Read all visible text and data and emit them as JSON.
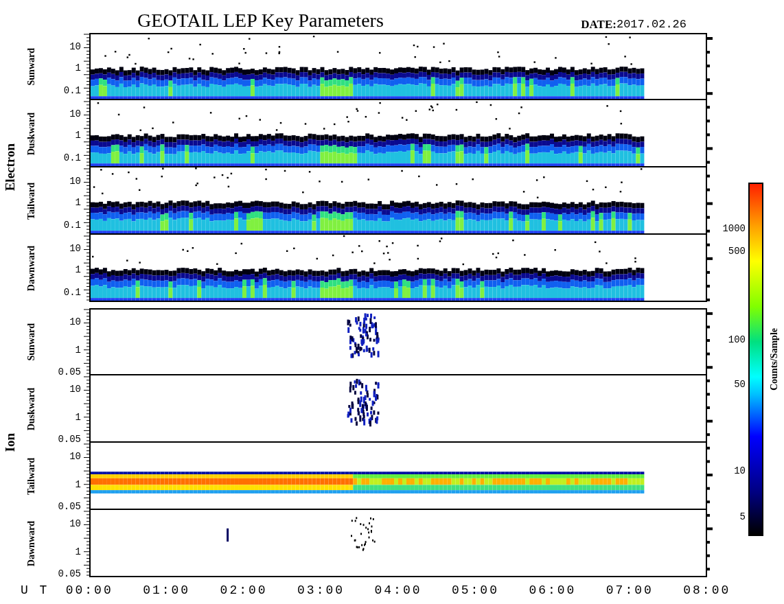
{
  "title": "GEOTAIL LEP Key Parameters",
  "date_label": "DATE:",
  "date_value": "2017.02.26",
  "groups": [
    {
      "name": "Electron",
      "panels": [
        {
          "direction": "Sunward",
          "kind": "electron",
          "yticks": [
            "10",
            "1",
            "0.1"
          ]
        },
        {
          "direction": "Duskward",
          "kind": "electron",
          "yticks": [
            "10",
            "1",
            "0.1"
          ]
        },
        {
          "direction": "Tailward",
          "kind": "electron",
          "yticks": [
            "10",
            "1",
            "0.1"
          ]
        },
        {
          "direction": "Dawnward",
          "kind": "electron",
          "yticks": [
            "10",
            "1",
            "0.1"
          ]
        }
      ]
    },
    {
      "name": "Ion",
      "panels": [
        {
          "direction": "Sunward",
          "kind": "burst",
          "yticks": [
            "10",
            "1",
            "0.05"
          ]
        },
        {
          "direction": "Duskward",
          "kind": "burst",
          "yticks": [
            "10",
            "1",
            "0.05"
          ]
        },
        {
          "direction": "Tailward",
          "kind": "band",
          "yticks": [
            "10",
            "1",
            "0.05"
          ]
        },
        {
          "direction": "Dawnward",
          "kind": "sparse",
          "yticks": [
            "10",
            "1",
            "0.05"
          ]
        }
      ]
    }
  ],
  "colorbar": {
    "label": "Counts/Sample",
    "ticks": [
      "1000",
      "500",
      "100",
      "50",
      "10",
      "5"
    ]
  },
  "time_axis": {
    "label": "U T",
    "ticks": [
      "00:00",
      "01:00",
      "02:00",
      "03:00",
      "04:00",
      "05:00",
      "06:00",
      "07:00",
      "08:00"
    ]
  }
}
